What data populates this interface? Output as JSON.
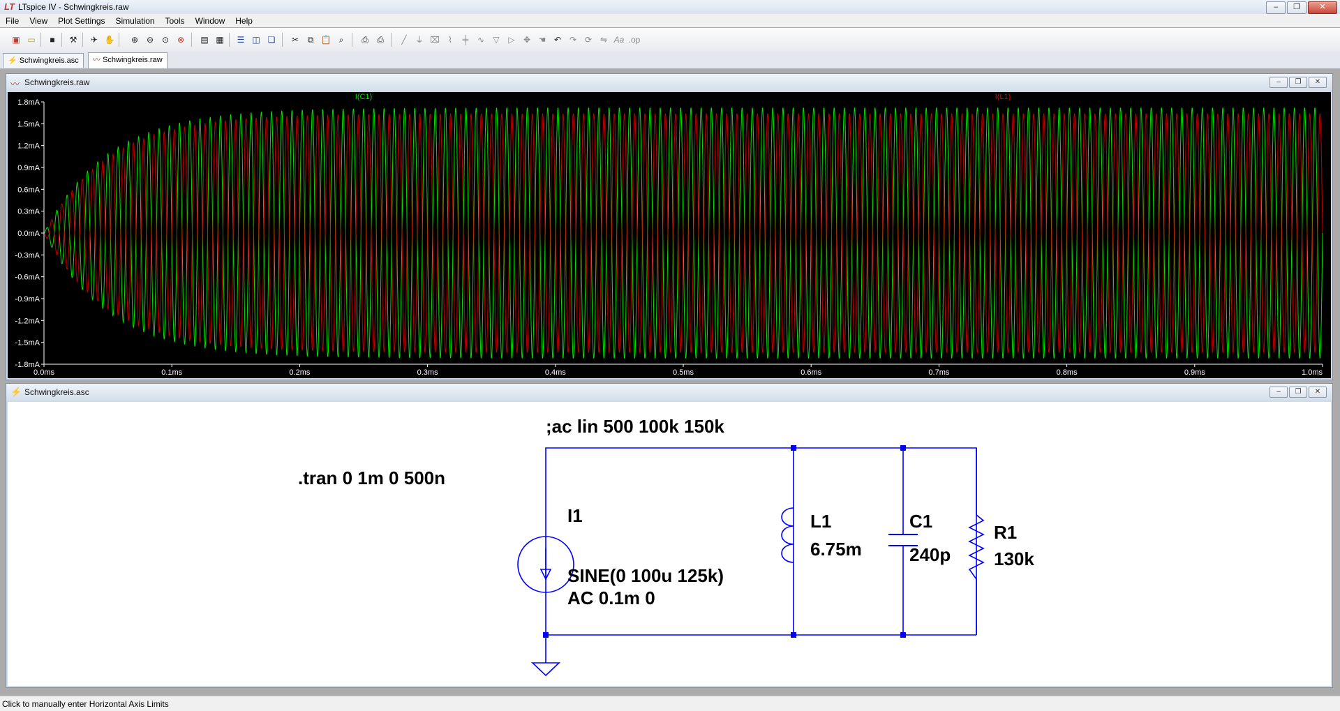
{
  "window": {
    "title": "LTspice IV - Schwingkreis.raw"
  },
  "menu": [
    "File",
    "View",
    "Plot Settings",
    "Simulation",
    "Tools",
    "Window",
    "Help"
  ],
  "toolbar": {
    "icons": [
      "new-schematic",
      "open",
      "save",
      "control-panel",
      "run",
      "halt",
      "zoom-in",
      "zoom-out",
      "zoom-full",
      "zoom-fit",
      "autorange",
      "grid",
      "tile-horizontal",
      "tile-vertical",
      "cascade",
      "cut",
      "copy",
      "paste",
      "find",
      "print-setup",
      "print",
      "wire",
      "ground",
      "label-net",
      "resistor",
      "capacitor",
      "inductor",
      "diode",
      "component",
      "move",
      "drag",
      "undo",
      "redo",
      "rotate",
      "mirror",
      "text",
      "spice-directive"
    ]
  },
  "tabs": [
    {
      "label": "Schwingkreis.asc",
      "active": false
    },
    {
      "label": "Schwingkreis.raw",
      "active": true
    }
  ],
  "plot_window": {
    "title": "Schwingkreis.raw"
  },
  "schematic_window": {
    "title": "Schwingkreis.asc"
  },
  "chart_data": {
    "type": "line",
    "title": "",
    "xlabel": "",
    "ylabel": "",
    "background": "#000000",
    "series": [
      {
        "name": "I(C1)",
        "color": "#00e000",
        "description_values": {
          "carrier_frequency_hz": 125000,
          "steady_amplitude_mA": 1.72,
          "envelope_rise_time_ms": 0.2,
          "t0_amplitude_mA": 0
        }
      },
      {
        "name": "I(L1)",
        "color": "#dd0000",
        "description_values": {
          "carrier_frequency_hz": 125000,
          "steady_amplitude_mA": 1.64,
          "envelope_rise_time_ms": 0.2,
          "t0_amplitude_mA": 0
        }
      }
    ],
    "x": {
      "range_ms": [
        0,
        1.0
      ],
      "ticks": [
        "0.0ms",
        "0.1ms",
        "0.2ms",
        "0.3ms",
        "0.4ms",
        "0.5ms",
        "0.6ms",
        "0.7ms",
        "0.8ms",
        "0.9ms",
        "1.0ms"
      ]
    },
    "y": {
      "range_mA": [
        -1.8,
        1.8
      ],
      "ticks": [
        "1.8mA",
        "1.5mA",
        "1.2mA",
        "0.9mA",
        "0.6mA",
        "0.3mA",
        "0.0mA",
        "-0.3mA",
        "-0.6mA",
        "-0.9mA",
        "-1.2mA",
        "-1.5mA",
        "-1.8mA"
      ]
    },
    "grid": false,
    "legend": "top, trace labels above plot"
  },
  "schematic": {
    "directive_ac": ";ac lin 500 100k 150k",
    "directive_tran": ".tran 0 1m 0 500n",
    "source": {
      "name": "I1",
      "value_line1": "SINE(0 100u 125k)",
      "value_line2": "AC 0.1m 0"
    },
    "inductor": {
      "name": "L1",
      "value": "6.75m"
    },
    "capacitor": {
      "name": "C1",
      "value": "240p"
    },
    "resistor": {
      "name": "R1",
      "value": "130k"
    }
  },
  "status": {
    "text": "Click to manually enter Horizontal Axis Limits"
  },
  "colors": {
    "wire": "#0000ff",
    "node": "#0000ff",
    "component": "#0000ff",
    "text": "#000000"
  }
}
